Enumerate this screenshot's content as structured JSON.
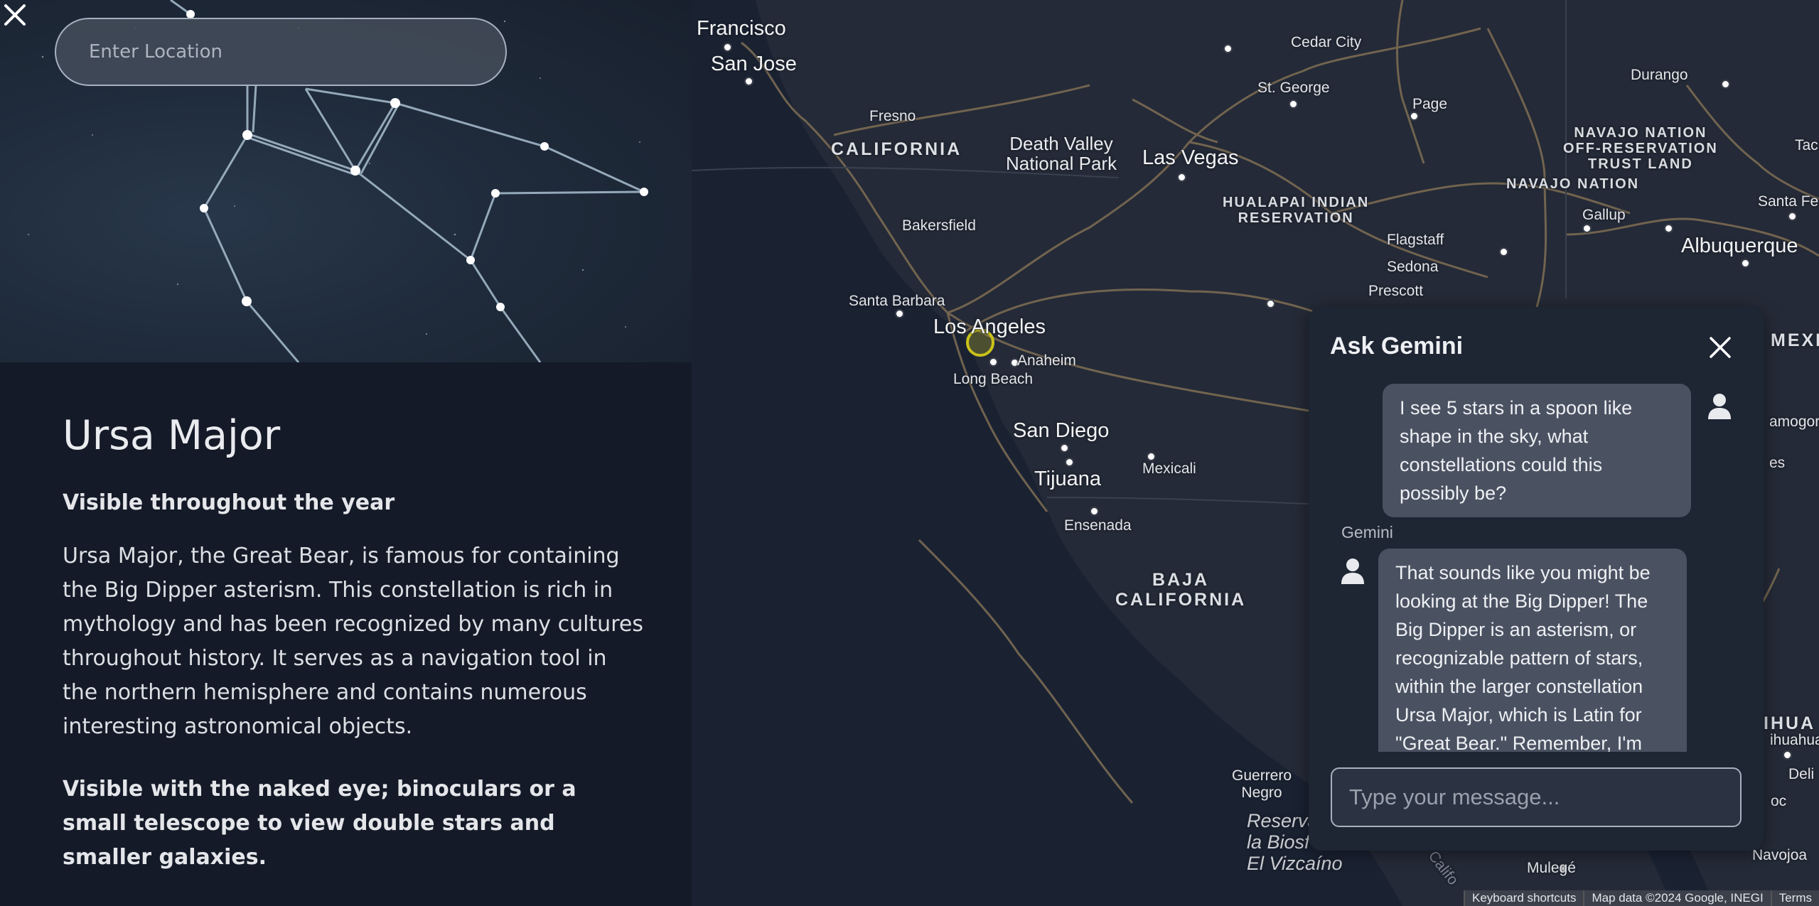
{
  "search": {
    "placeholder": "Enter Location"
  },
  "constellation": {
    "name": "Ursa Major",
    "visibility": "Visible throughout the year",
    "description": "Ursa Major, the Great Bear, is famous for containing the Big Dipper asterism. This constellation is rich in mythology and has been recognized by many cultures throughout history. It serves as a navigation tool in the northern hemisphere and contains numerous interesting astronomical objects.",
    "viewing": "Visible with the naked eye; binoculars or a small telescope to view double stars and smaller galaxies."
  },
  "map": {
    "labels": {
      "francisco": "Francisco",
      "san_jose": "San Jose",
      "fresno": "Fresno",
      "california": "CALIFORNIA",
      "death_valley": "Death Valley\nNational Park",
      "las_vegas": "Las Vegas",
      "cedar_city": "Cedar City",
      "st_george": "St. George",
      "page": "Page",
      "durango": "Durango",
      "navajo_offres": "NAVAJO NATION\nOFF-RESERVATION\nTRUST LAND",
      "navajo_nation": "NAVAJO NATION",
      "tac": "Tac",
      "hualapai": "HUALAPAI INDIAN\nRESERVATION",
      "bakersfield": "Bakersfield",
      "flagstaff": "Flagstaff",
      "gallup": "Gallup",
      "santa_fe": "Santa Fe",
      "albuquerque": "Albuquerque",
      "sedona": "Sedona",
      "santa_barbara": "Santa Barbara",
      "prescott": "Prescott",
      "los_angeles": "Los Angeles",
      "anaheim": "Anaheim",
      "long_beach": "Long Beach",
      "mex": "MEXI",
      "amogord": "amogord",
      "es": "es",
      "san_diego": "San Diego",
      "tijuana": "Tijuana",
      "mexicali": "Mexicali",
      "ensenada": "Ensenada",
      "baja": "BAJA\nCALIFORNIA",
      "ihua": "IHUA",
      "ihuahua": "ihuahua",
      "deli": "Deli",
      "oc": "oc",
      "guerrero": "Guerrero\nNegro",
      "reserva": "Reserva\nla Biosf\nEl Vizcaíno",
      "mulege": "Mulegé",
      "navojoa": "Navojoa",
      "calif": "Califo"
    },
    "attribution": [
      "Keyboard shortcuts",
      "Map data ©2024 Google, INEGI",
      "Terms"
    ]
  },
  "chat": {
    "title": "Ask Gemini",
    "messages": [
      {
        "role": "user",
        "text": "I see 5 stars in a spoon like shape in the sky, what constellations could this possibly be?"
      },
      {
        "role": "model",
        "sender": "Gemini",
        "text": "That sounds like you might be looking at the Big Dipper! The Big Dipper is an asterism, or recognizable pattern of stars, within the larger constellation Ursa Major, which is Latin for \"Great Bear.\" Remember, I'm"
      }
    ],
    "input_placeholder": "Type your message..."
  },
  "colors": {
    "panel_bg": "#141a27",
    "map_bg": "#242a37",
    "chat_bg": "#1e2533",
    "bubble": "#4a5262",
    "roads": "#7a6a52",
    "location_marker": "#c9c21a"
  },
  "icons": {
    "close": "close-icon",
    "user": "user-icon"
  }
}
